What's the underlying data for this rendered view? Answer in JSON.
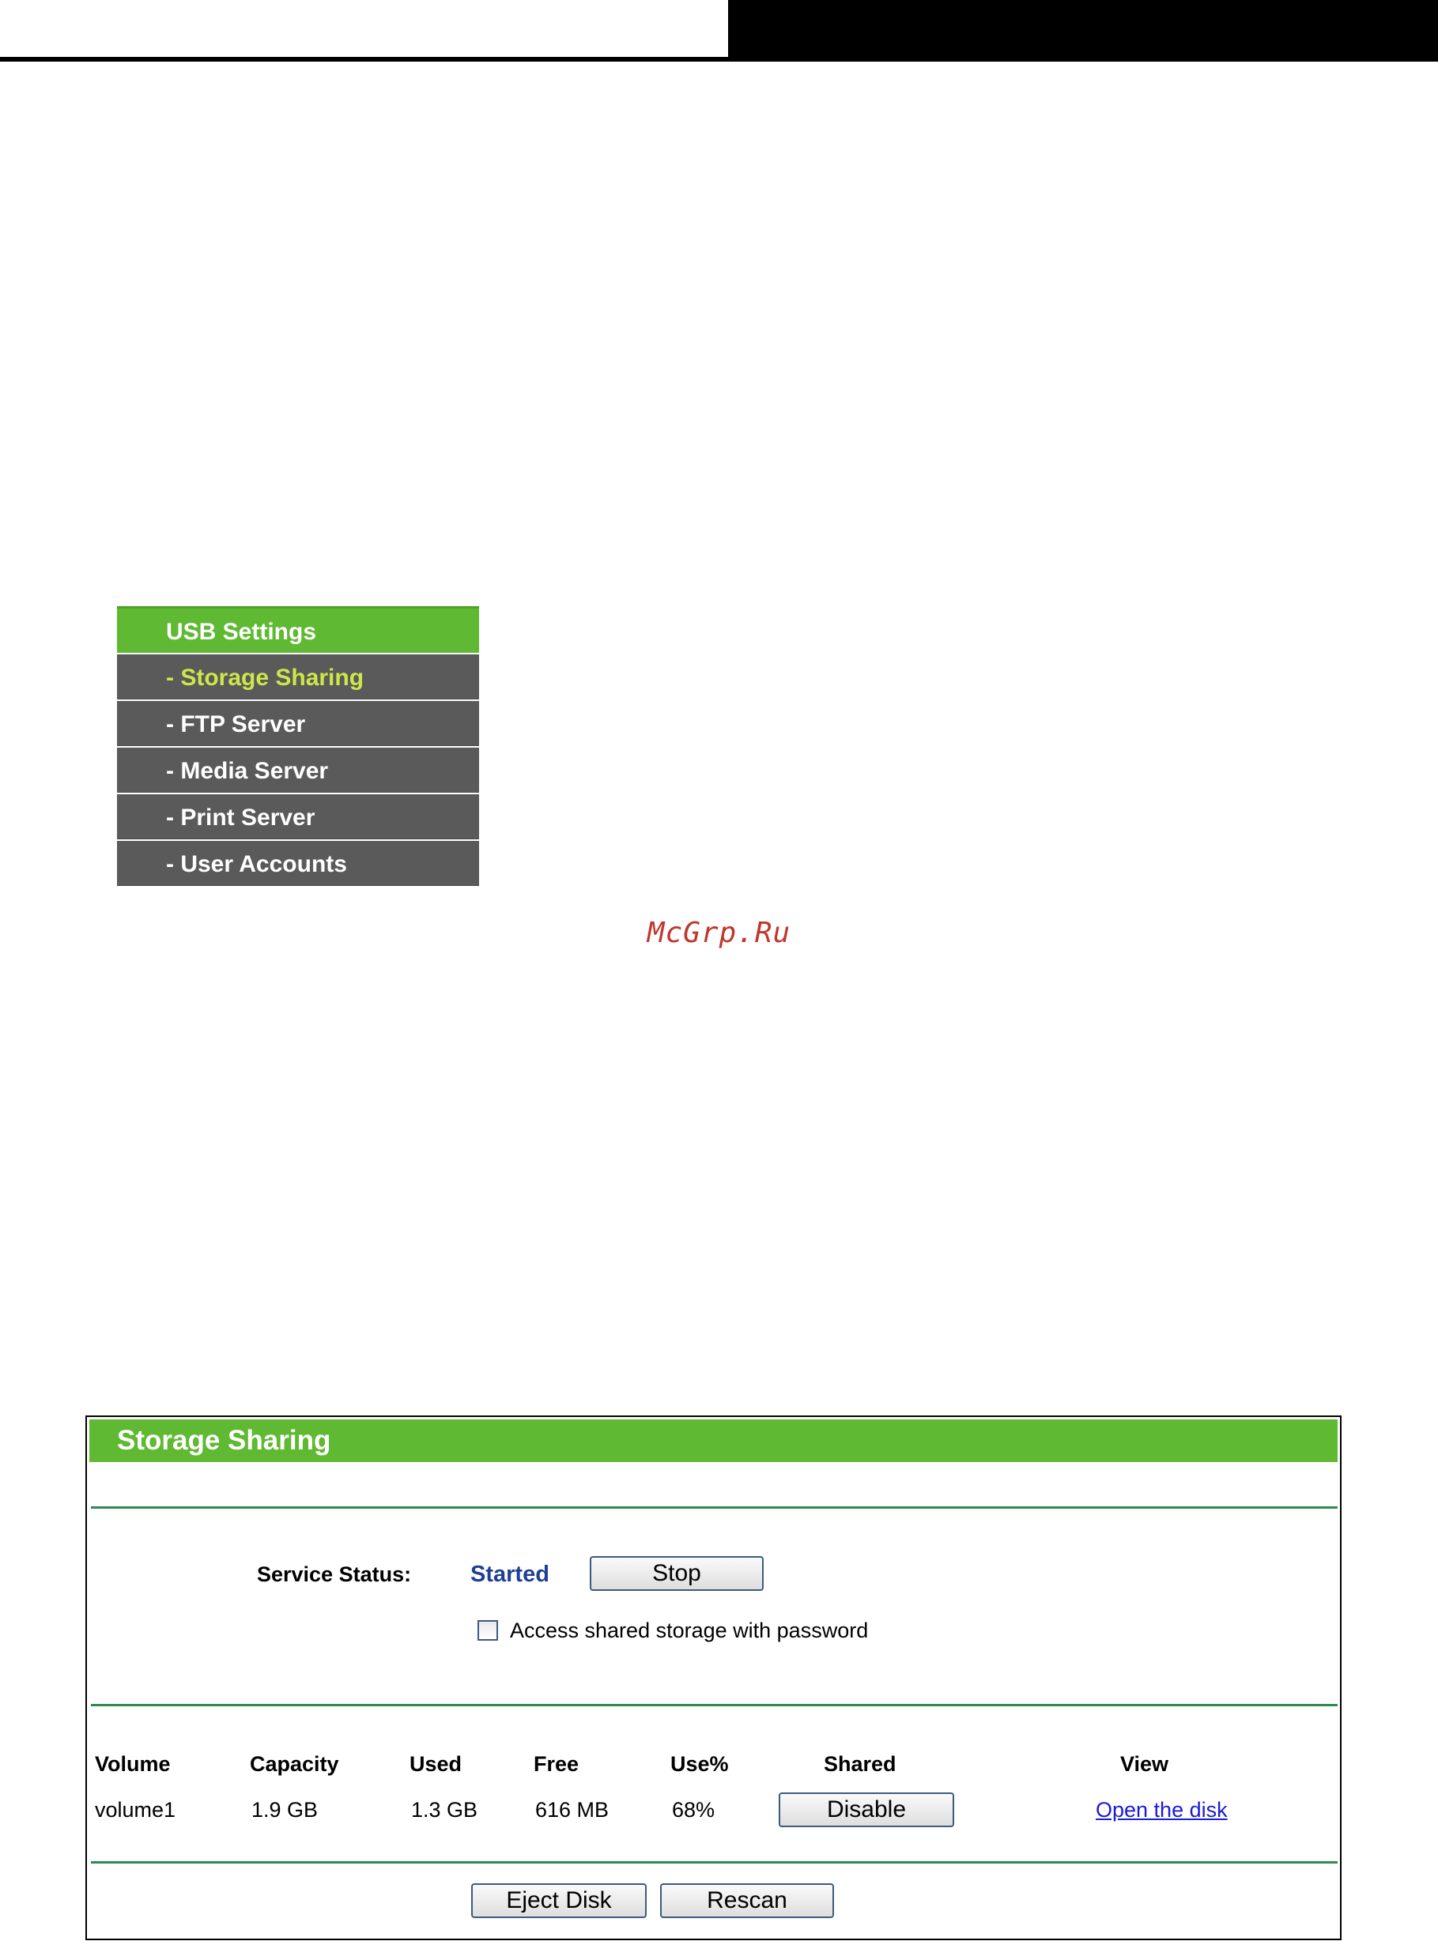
{
  "menu": {
    "header": "USB Settings",
    "items": [
      {
        "label": "- Storage Sharing",
        "active": true
      },
      {
        "label": "- FTP Server",
        "active": false
      },
      {
        "label": "- Media Server",
        "active": false
      },
      {
        "label": "- Print Server",
        "active": false
      },
      {
        "label": "- User Accounts",
        "active": false
      }
    ]
  },
  "watermark": "McGrp.Ru",
  "panel": {
    "title": "Storage Sharing",
    "service_status_label": "Service Status:",
    "service_status_value": "Started",
    "stop_button": "Stop",
    "password_checkbox_label": "Access shared storage with password",
    "password_checkbox_checked": false,
    "table": {
      "headers": [
        "Volume",
        "Capacity",
        "Used",
        "Free",
        "Use%",
        "Shared",
        "View"
      ],
      "rows": [
        {
          "volume": "volume1",
          "capacity": "1.9 GB",
          "used": "1.3 GB",
          "free": "616 MB",
          "use_percent": "68%",
          "shared_button": "Disable",
          "view_link": "Open the disk"
        }
      ]
    },
    "eject_button": "Eject Disk",
    "rescan_button": "Rescan"
  },
  "colors": {
    "green_header": "#5fb932",
    "menu_gray": "#5a5a5a",
    "active_item": "#cde74a",
    "status_blue": "#1f3f96",
    "divider_green": "#2f8a4f",
    "link_blue": "#1a1ad8",
    "watermark_red": "#c0362c"
  }
}
